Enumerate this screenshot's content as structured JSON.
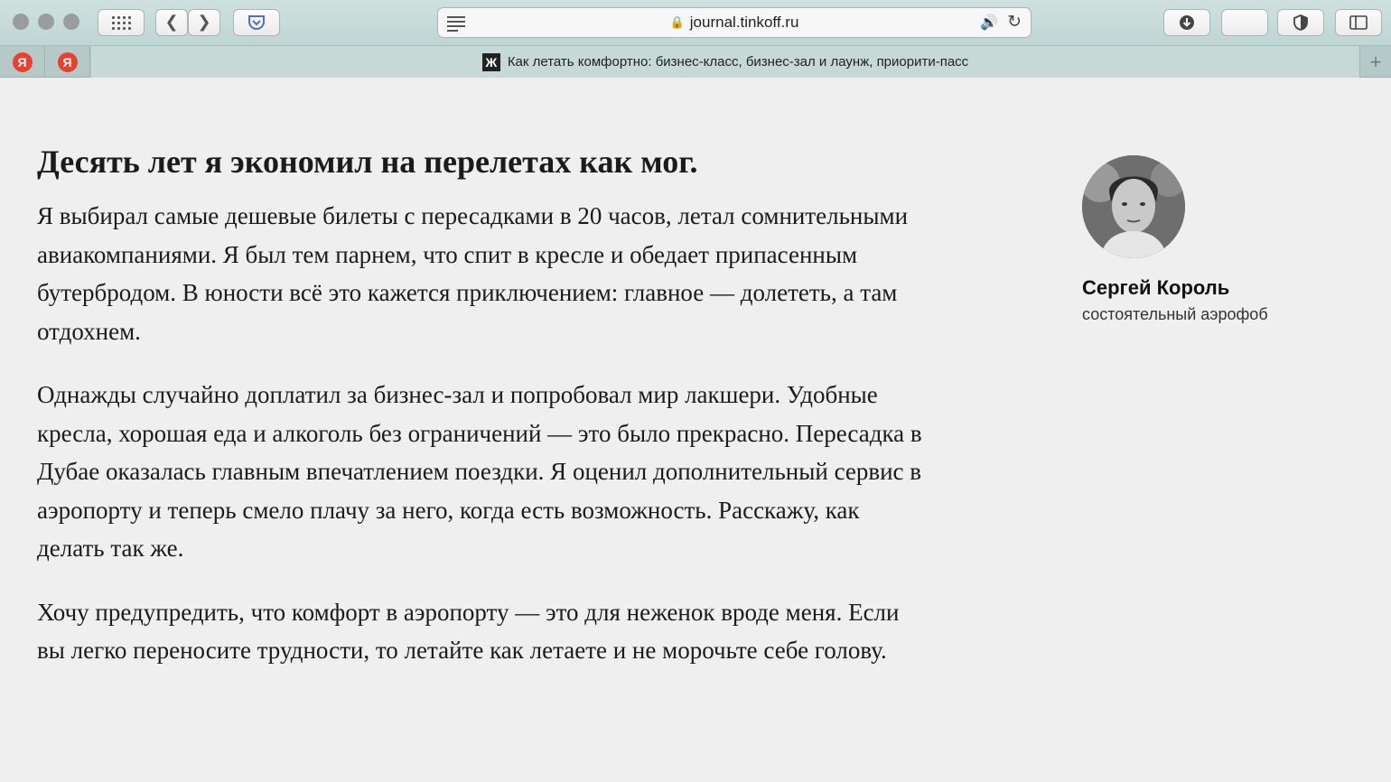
{
  "browser": {
    "address": "journal.tinkoff.ru",
    "tab_title": "Как летать комфортно: бизнес-класс, бизнес-зал и лаунж, приорити-пасс",
    "pinned_tabs": [
      {
        "label": "Я"
      },
      {
        "label": "Я"
      }
    ],
    "favicon_letter": "Ж",
    "icons": [
      "grid-icon",
      "back-icon",
      "forward-icon",
      "pocket-icon",
      "reader-icon",
      "lock-icon",
      "audio-icon",
      "reload-icon",
      "download-icon",
      "shield-icon",
      "sidebar-icon",
      "plus-icon"
    ]
  },
  "article": {
    "lead": "Десять лет я экономил на перелетах как мог.",
    "paragraphs": [
      "Я выбирал самые дешевые билеты с пересадками в 20 часов, летал сомнительными авиакомпаниями. Я был тем парнем, что спит в кресле и обедает припасенным бутербродом. В юности всё это кажется приключением: главное — долететь, а там отдохнем.",
      "Однажды случайно доплатил за бизнес-зал и попробовал мир лакшери. Удобные кресла, хорошая еда и алкоголь без ограничений — это было прекрасно. Пересадка в Дубае оказалась главным впечатлением поездки. Я оценил дополнительный сервис в аэропорту и теперь смело плачу за него, когда есть возможность. Расскажу, как делать так же.",
      "Хочу предупредить, что комфорт в аэропорту — это для неженок вроде меня. Если вы легко переносите трудности, то летайте как летаете и не морочьте себе голову."
    ]
  },
  "author": {
    "name": "Сергей Король",
    "role": "состоятельный аэрофоб"
  }
}
